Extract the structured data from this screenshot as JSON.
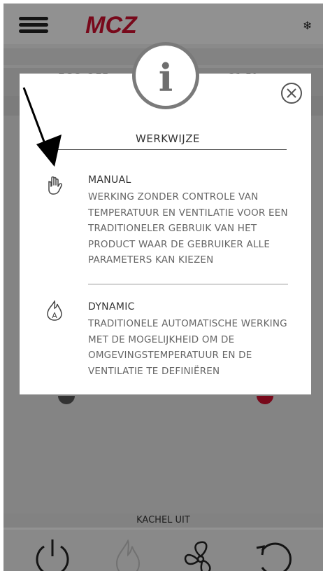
{
  "header": {
    "logo_text": "MCZ",
    "snow_icon": "snowflake-icon"
  },
  "status": {
    "left": "ECO OFF",
    "right": "21,5°"
  },
  "modal": {
    "title": "WERKWIJZE",
    "items": [
      {
        "title": "MANUAL",
        "icon": "hand-icon",
        "lines": [
          "WERKING ZONDER CONTROLE VAN",
          "TEMPERATUUR EN VENTILATIE VOOR EEN",
          "TRADITIONELER GEBRUIK VAN HET",
          "PRODUCT WAAR DE GEBRUIKER ALLE",
          "PARAMETERS KAN KIEZEN"
        ]
      },
      {
        "title": "DYNAMIC",
        "icon": "flame-auto-icon",
        "lines": [
          "TRADITIONELE AUTOMATISCHE WERKING",
          "MET DE MOGELIJKHEID OM DE",
          "OMGEVINGSTEMPERATUUR EN DE",
          "VENTILATIE TE DEFINIËREN"
        ]
      }
    ]
  },
  "footer": {
    "status_label": "KACHEL UIT"
  },
  "colors": {
    "brand_red": "#c8102e",
    "text_dark": "#333333",
    "text_gray": "#666666"
  }
}
